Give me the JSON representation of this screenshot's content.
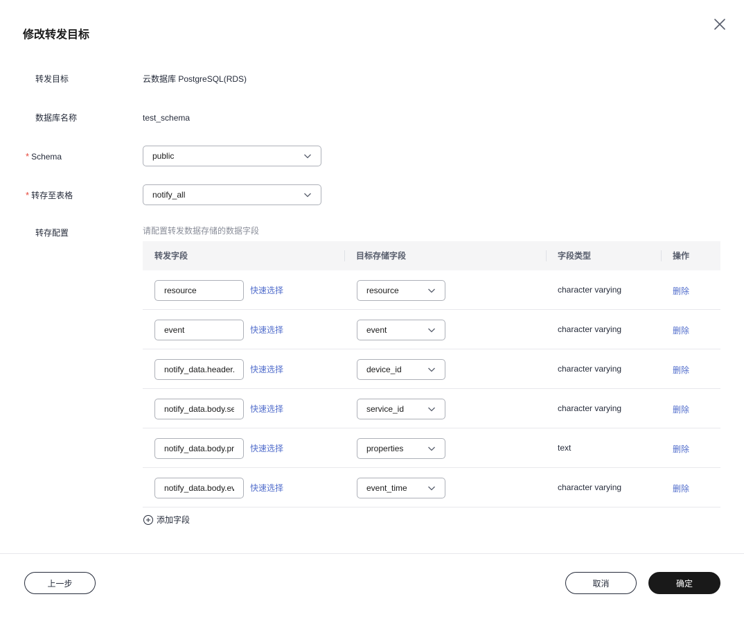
{
  "dialog": {
    "title": "修改转发目标",
    "close_icon": "close-icon"
  },
  "form": {
    "target_label": "转发目标",
    "target_value": "云数据库 PostgreSQL(RDS)",
    "db_name_label": "数据库名称",
    "db_name_value": "test_schema",
    "schema_label": "Schema",
    "schema_value": "public",
    "table_label": "转存至表格",
    "table_value": "notify_all",
    "config_label": "转存配置",
    "config_hint": "请配置转发数据存储的数据字段",
    "required_mark": "*"
  },
  "table": {
    "headers": {
      "source_field": "转发字段",
      "target_field": "目标存储字段",
      "field_type": "字段类型",
      "action": "操作"
    },
    "quick_select_label": "快速选择",
    "delete_label": "删除",
    "rows": [
      {
        "source": "resource",
        "target": "resource",
        "type": "character varying"
      },
      {
        "source": "event",
        "target": "event",
        "type": "character varying"
      },
      {
        "source": "notify_data.header.device_id",
        "target": "device_id",
        "type": "character varying"
      },
      {
        "source": "notify_data.body.service_id",
        "target": "service_id",
        "type": "character varying"
      },
      {
        "source": "notify_data.body.properties",
        "target": "properties",
        "type": "text"
      },
      {
        "source": "notify_data.body.event_time",
        "target": "event_time",
        "type": "character varying"
      }
    ]
  },
  "add_field_label": "添加字段",
  "footer": {
    "prev_label": "上一步",
    "cancel_label": "取消",
    "confirm_label": "确定"
  },
  "colors": {
    "link": "#526ecc",
    "required": "#e5453a",
    "primary_button": "#191919"
  }
}
